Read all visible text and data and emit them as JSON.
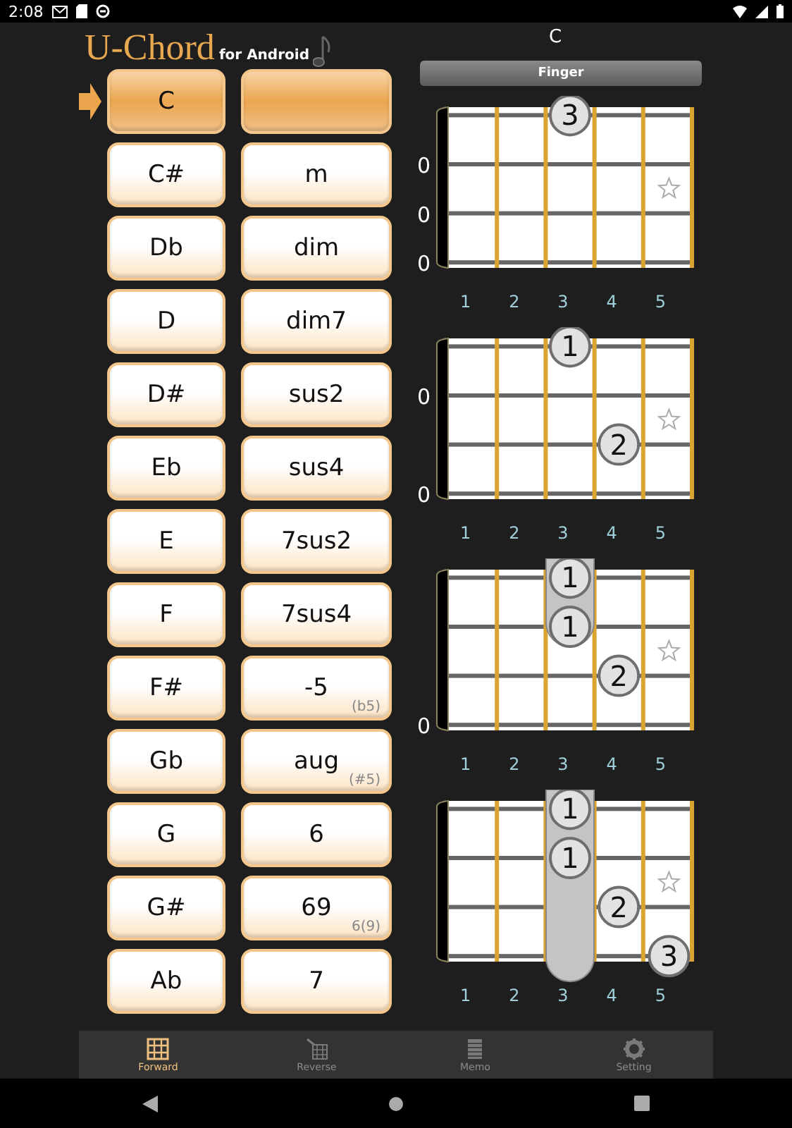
{
  "status_bar": {
    "time": "2:08"
  },
  "header": {
    "title": "U-Chord",
    "subtitle": "for Android"
  },
  "roots": [
    {
      "label": "C",
      "selected": true
    },
    {
      "label": "C#",
      "selected": false
    },
    {
      "label": "Db",
      "selected": false
    },
    {
      "label": "D",
      "selected": false
    },
    {
      "label": "D#",
      "selected": false
    },
    {
      "label": "Eb",
      "selected": false
    },
    {
      "label": "E",
      "selected": false
    },
    {
      "label": "F",
      "selected": false
    },
    {
      "label": "F#",
      "selected": false
    },
    {
      "label": "Gb",
      "selected": false
    },
    {
      "label": "G",
      "selected": false
    },
    {
      "label": "G#",
      "selected": false
    },
    {
      "label": "Ab",
      "selected": false
    }
  ],
  "qualities": [
    {
      "selected": true
    },
    {
      "label": "m",
      "selected": false
    },
    {
      "label": "dim",
      "selected": false
    },
    {
      "label": "dim7",
      "selected": false
    },
    {
      "label": "sus2",
      "selected": false
    },
    {
      "label": "sus4",
      "selected": false
    },
    {
      "label": "7sus2",
      "selected": false
    },
    {
      "label": "7sus4",
      "selected": false
    },
    {
      "label": "-5",
      "note": "(b5)",
      "selected": false
    },
    {
      "label": "aug",
      "note": "(#5)",
      "selected": false
    },
    {
      "label": "6",
      "selected": false
    },
    {
      "label": "69",
      "note": "6(9)",
      "selected": false
    },
    {
      "label": "7",
      "selected": false
    }
  ],
  "chord_panel": {
    "chord_name": "C",
    "mode_button": "Finger",
    "diagrams": [
      {
        "strings": [
          {
            "cells": [
              {
                "kind": "empty"
              },
              {
                "kind": "empty"
              },
              {
                "kind": "dot",
                "label": "3"
              },
              {
                "kind": "empty"
              },
              {
                "kind": "empty"
              }
            ]
          },
          {
            "open": "0",
            "cells": [
              {
                "kind": "empty"
              },
              {
                "kind": "empty"
              },
              {
                "kind": "empty"
              },
              {
                "kind": "empty"
              },
              {
                "kind": "star"
              }
            ]
          },
          {
            "open": "0",
            "cells": [
              {
                "kind": "empty"
              },
              {
                "kind": "empty"
              },
              {
                "kind": "empty"
              },
              {
                "kind": "empty"
              },
              {
                "kind": "empty"
              }
            ]
          },
          {
            "open": "0",
            "cells": [
              {
                "kind": "empty"
              },
              {
                "kind": "empty"
              },
              {
                "kind": "empty"
              },
              {
                "kind": "empty"
              },
              {
                "kind": "empty"
              }
            ]
          }
        ],
        "fret_numbers": [
          "1",
          "2",
          "3",
          "4",
          "5"
        ]
      },
      {
        "strings": [
          {
            "cells": [
              {
                "kind": "empty"
              },
              {
                "kind": "empty"
              },
              {
                "kind": "dot",
                "label": "1"
              },
              {
                "kind": "empty"
              },
              {
                "kind": "empty"
              }
            ]
          },
          {
            "open": "0",
            "cells": [
              {
                "kind": "empty"
              },
              {
                "kind": "empty"
              },
              {
                "kind": "empty"
              },
              {
                "kind": "empty"
              },
              {
                "kind": "star"
              }
            ]
          },
          {
            "cells": [
              {
                "kind": "empty"
              },
              {
                "kind": "empty"
              },
              {
                "kind": "empty"
              },
              {
                "kind": "dot",
                "label": "2"
              },
              {
                "kind": "empty"
              }
            ]
          },
          {
            "open": "0",
            "cells": [
              {
                "kind": "empty"
              },
              {
                "kind": "empty"
              },
              {
                "kind": "empty"
              },
              {
                "kind": "empty"
              },
              {
                "kind": "empty"
              }
            ]
          }
        ],
        "fret_numbers": [
          "1",
          "2",
          "3",
          "4",
          "5"
        ]
      },
      {
        "strings": [
          {
            "cells": [
              {
                "kind": "empty"
              },
              {
                "kind": "empty"
              },
              {
                "kind": "barre_dot",
                "label": "1"
              },
              {
                "kind": "empty"
              },
              {
                "kind": "empty"
              }
            ]
          },
          {
            "cells": [
              {
                "kind": "empty"
              },
              {
                "kind": "empty"
              },
              {
                "kind": "barre_dot",
                "label": "1"
              },
              {
                "kind": "empty"
              },
              {
                "kind": "star"
              }
            ]
          },
          {
            "cells": [
              {
                "kind": "empty"
              },
              {
                "kind": "empty"
              },
              {
                "kind": "empty"
              },
              {
                "kind": "dot",
                "label": "2"
              },
              {
                "kind": "empty"
              }
            ]
          },
          {
            "open": "0",
            "cells": [
              {
                "kind": "empty"
              },
              {
                "kind": "empty"
              },
              {
                "kind": "empty"
              },
              {
                "kind": "empty"
              },
              {
                "kind": "empty"
              }
            ]
          }
        ],
        "fret_numbers": [
          "1",
          "2",
          "3",
          "4",
          "5"
        ]
      },
      {
        "strings": [
          {
            "cells": [
              {
                "kind": "empty"
              },
              {
                "kind": "empty"
              },
              {
                "kind": "barre_dot",
                "label": "1"
              },
              {
                "kind": "empty"
              },
              {
                "kind": "empty"
              }
            ]
          },
          {
            "cells": [
              {
                "kind": "empty"
              },
              {
                "kind": "empty"
              },
              {
                "kind": "barre_dot",
                "label": "1"
              },
              {
                "kind": "empty"
              },
              {
                "kind": "star"
              }
            ]
          },
          {
            "cells": [
              {
                "kind": "empty"
              },
              {
                "kind": "empty"
              },
              {
                "kind": "barre"
              },
              {
                "kind": "dot",
                "label": "2"
              },
              {
                "kind": "empty"
              }
            ]
          },
          {
            "cells": [
              {
                "kind": "empty"
              },
              {
                "kind": "empty"
              },
              {
                "kind": "barre"
              },
              {
                "kind": "empty"
              },
              {
                "kind": "dot",
                "label": "3"
              }
            ]
          }
        ],
        "fret_numbers": [
          "1",
          "2",
          "3",
          "4",
          "5"
        ]
      }
    ]
  },
  "tabs": [
    {
      "kind": "forward",
      "label": "Forward",
      "selected": true
    },
    {
      "kind": "reverse",
      "label": "Reverse",
      "selected": false
    },
    {
      "kind": "memo",
      "label": "Memo",
      "selected": false
    },
    {
      "kind": "setting",
      "label": "Setting",
      "selected": false
    }
  ]
}
